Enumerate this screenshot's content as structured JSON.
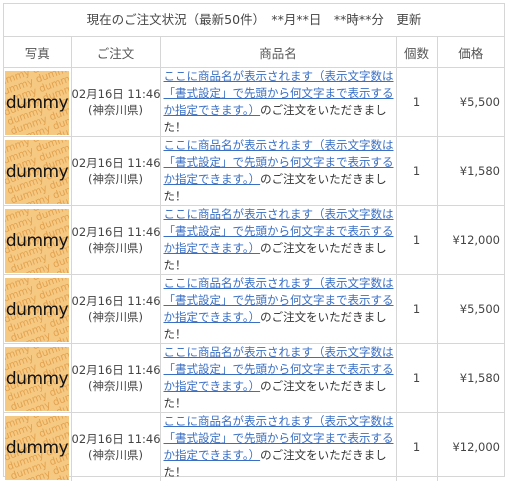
{
  "header": {
    "title": "現在のご注文状況（最新50件）　**月**日　**時**分　更新"
  },
  "columns": {
    "photo": "写真",
    "order": "ご注文",
    "name": "商品名",
    "qty": "個数",
    "price": "価格"
  },
  "thumbnail": {
    "pattern": "dummy dummy dummy dummy",
    "label": "dummy"
  },
  "rows": [
    {
      "date": "02月16日 11:46",
      "region": "(神奈川県)",
      "product_link": "ここに商品名が表示されます（表示文字数は「書式設定」で先頭から何文字まで表示するか指定できます。）",
      "product_suffix": "のご注文をいただきました！",
      "qty": "1",
      "price": "¥5,500"
    },
    {
      "date": "02月16日 11:46",
      "region": "(神奈川県)",
      "product_link": "ここに商品名が表示されます（表示文字数は「書式設定」で先頭から何文字まで表示するか指定できます。）",
      "product_suffix": "のご注文をいただきました！",
      "qty": "1",
      "price": "¥1,580"
    },
    {
      "date": "02月16日 11:46",
      "region": "(神奈川県)",
      "product_link": "ここに商品名が表示されます（表示文字数は「書式設定」で先頭から何文字まで表示するか指定できます。）",
      "product_suffix": "のご注文をいただきました！",
      "qty": "1",
      "price": "¥12,000"
    },
    {
      "date": "02月16日 11:46",
      "region": "(神奈川県)",
      "product_link": "ここに商品名が表示されます（表示文字数は「書式設定」で先頭から何文字まで表示するか指定できます。）",
      "product_suffix": "のご注文をいただきました！",
      "qty": "1",
      "price": "¥5,500"
    },
    {
      "date": "02月16日 11:46",
      "region": "(神奈川県)",
      "product_link": "ここに商品名が表示されます（表示文字数は「書式設定」で先頭から何文字まで表示するか指定できます。）",
      "product_suffix": "のご注文をいただきました！",
      "qty": "1",
      "price": "¥1,580"
    },
    {
      "date": "02月16日 11:46",
      "region": "(神奈川県)",
      "product_link": "ここに商品名が表示されます（表示文字数は「書式設定」で先頭から何文字まで表示するか指定できます。）",
      "product_suffix": "のご注文をいただきました！",
      "qty": "1",
      "price": "¥12,000"
    }
  ]
}
